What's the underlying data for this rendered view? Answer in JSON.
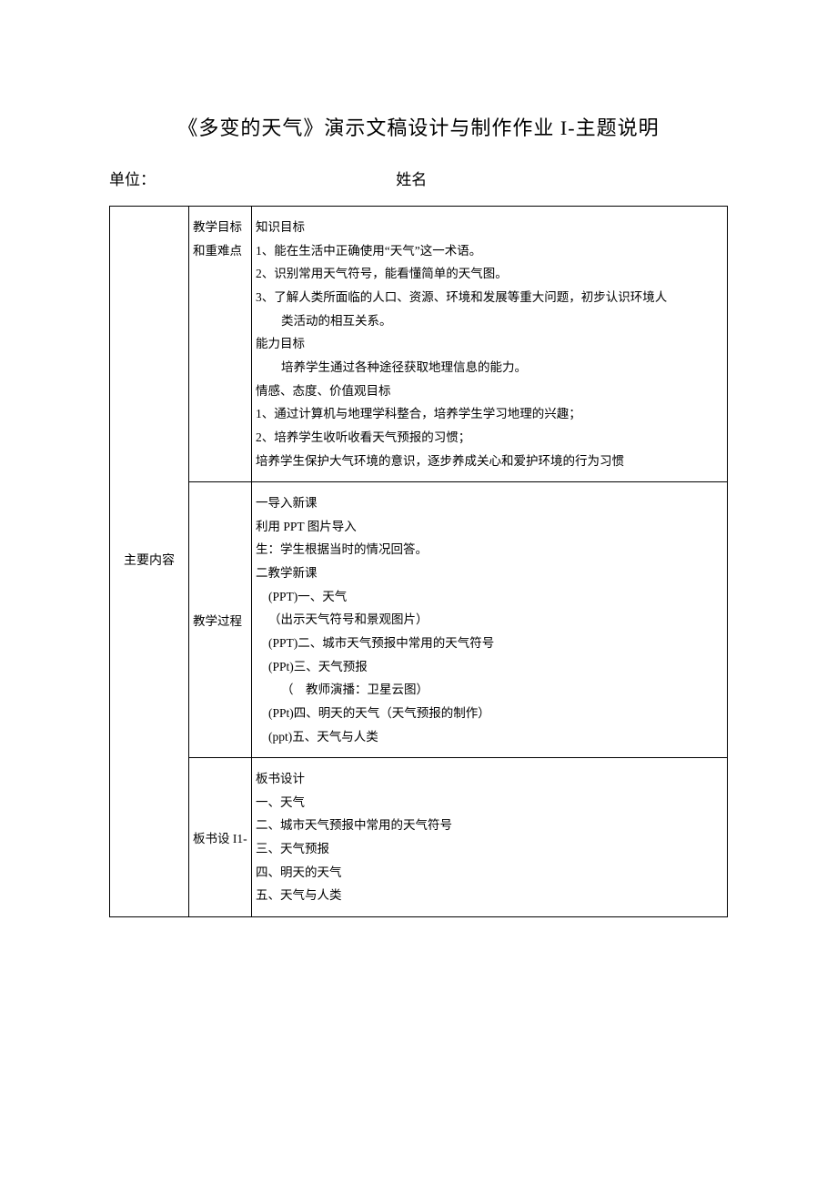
{
  "title": "《多变的天气》演示文稿设计与制作作业 I-主题说明",
  "meta": {
    "unit_label": "单位：",
    "name_label": "姓名"
  },
  "rowSpanLabel": "主要内容",
  "sections": [
    {
      "sideLabel": "教学目标和重难点",
      "lines": [
        {
          "text": "知识目标",
          "cls": ""
        },
        {
          "text": "1、能在生活中正确使用“天气”这一术语。",
          "cls": ""
        },
        {
          "text": "2、识别常用天气符号，能看懂简单的天气图。",
          "cls": ""
        },
        {
          "text": "3、了解人类所面临的人口、资源、环境和发展等重大问题，初步认识环境人",
          "cls": ""
        },
        {
          "text": "类活动的相互关系。",
          "cls": "indent2"
        },
        {
          "text": "能力目标",
          "cls": ""
        },
        {
          "text": "培养学生通过各种途径获取地理信息的能力。",
          "cls": "indent2"
        },
        {
          "text": "情感、态度、价值观目标",
          "cls": ""
        },
        {
          "text": "1、通过计算机与地理学科整合，培养学生学习地理的兴趣；",
          "cls": ""
        },
        {
          "text": "2、培养学生收听收看天气预报的习惯；",
          "cls": ""
        },
        {
          "text": "培养学生保护大气环境的意识，逐步养成关心和爱护环境的行为习惯",
          "cls": ""
        }
      ]
    },
    {
      "sideLabel": "教学过程",
      "lines": [
        {
          "text": "一导入新课",
          "cls": ""
        },
        {
          "text": "利用 PPT 图片导入",
          "cls": ""
        },
        {
          "text": "生：学生根据当时的情况回答。",
          "cls": ""
        },
        {
          "text": "二教学新课",
          "cls": ""
        },
        {
          "text": "(PPT)一、天气",
          "cls": "indent3"
        },
        {
          "text": "（出示天气符号和景观图片）",
          "cls": "indent3"
        },
        {
          "text": "(PPT)二、城市天气预报中常用的天气符号",
          "cls": "indent3"
        },
        {
          "text": "(PPt)三、天气预报",
          "cls": "indent3"
        },
        {
          "text": "（　教师演播：卫星云图）",
          "cls": "indent2"
        },
        {
          "text": "(PPt)四、明天的天气（天气预报的制作）",
          "cls": "indent3"
        },
        {
          "text": " ",
          "cls": ""
        },
        {
          "text": "(ppt)五、天气与人类",
          "cls": "indent3"
        },
        {
          "text": " ",
          "cls": ""
        },
        {
          "text": " ",
          "cls": ""
        }
      ]
    },
    {
      "sideLabel": "板书设 I1-",
      "lines": [
        {
          "text": "板书设计",
          "cls": ""
        },
        {
          "text": "一、天气",
          "cls": ""
        },
        {
          "text": "二、城市天气预报中常用的天气符号",
          "cls": ""
        },
        {
          "text": "三、天气预报",
          "cls": ""
        },
        {
          "text": "四、明天的天气",
          "cls": ""
        },
        {
          "text": "五、天气与人类",
          "cls": ""
        }
      ]
    }
  ]
}
